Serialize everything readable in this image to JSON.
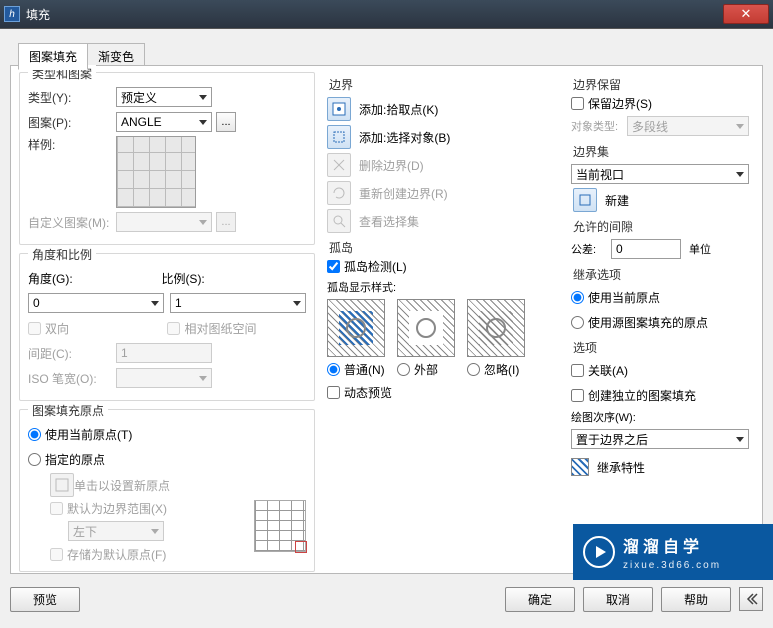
{
  "window": {
    "title": "填充"
  },
  "tabs": {
    "patternFill": "图案填充",
    "gradient": "渐变色"
  },
  "typeGroup": {
    "legend": "类型和图案",
    "rows": {
      "type": {
        "label": "类型(Y):",
        "value": "预定义"
      },
      "pattern": {
        "label": "图案(P):",
        "value": "ANGLE"
      },
      "sample": {
        "label": "样例:"
      },
      "custom": {
        "label": "自定义图案(M):",
        "value": ""
      }
    },
    "ellipsis": "..."
  },
  "scaleGroup": {
    "legend": "角度和比例",
    "angleLabel": "角度(G):",
    "angleValue": "0",
    "scaleLabel": "比例(S):",
    "scaleValue": "1",
    "bidi": "双向",
    "paperSpace": "相对图纸空间",
    "spacingLabel": "间距(C):",
    "spacingValue": "1",
    "isoPenLabel": "ISO 笔宽(O):",
    "isoPenValue": ""
  },
  "origin": {
    "legend": "图案填充原点",
    "useCurrent": "使用当前原点(T)",
    "specify": "指定的原点",
    "clickNew": "单击以设置新原点",
    "defaultExtent": "默认为边界范围(X)",
    "extentValue": "左下",
    "storeDefault": "存储为默认原点(F)"
  },
  "boundary": {
    "title": "边界",
    "rows": {
      "pick": "添加:拾取点(K)",
      "select": "添加:选择对象(B)",
      "remove": "删除边界(D)",
      "recreate": "重新创建边界(R)",
      "view": "查看选择集"
    }
  },
  "island": {
    "title": "孤岛",
    "detect": "孤岛检测(L)",
    "styleLabel": "孤岛显示样式:",
    "o1": "普通(N)",
    "o2": "外部",
    "o3": "忽略(I)"
  },
  "dynamicPreview": "动态预览",
  "bretain": {
    "title": "边界保留",
    "retain": "保留边界(S)",
    "objTypeLabel": "对象类型:",
    "objTypeValue": "多段线"
  },
  "bset": {
    "title": "边界集",
    "value": "当前视口",
    "newBtn": "新建"
  },
  "gap": {
    "title": "允许的间隙",
    "tolLabel": "公差:",
    "tolValue": "0",
    "unit": "单位"
  },
  "inherit": {
    "title": "继承选项",
    "opt1": "使用当前原点",
    "opt2": "使用源图案填充的原点"
  },
  "options": {
    "title": "选项",
    "assoc": "关联(A)",
    "independent": "创建独立的图案填充",
    "orderLabel": "绘图次序(W):",
    "orderValue": "置于边界之后",
    "inheritProps": "继承特性"
  },
  "footer": {
    "preview": "预览",
    "ok": "确定",
    "cancel": "取消",
    "help": "帮助"
  },
  "brand": {
    "name": "溜溜自学",
    "url": "zixue.3d66.com"
  }
}
